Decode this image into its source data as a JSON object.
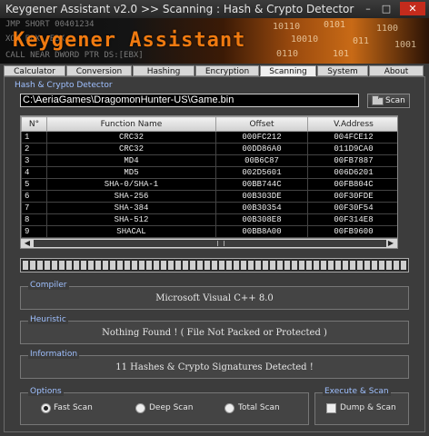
{
  "window": {
    "title": "Keygener Assistant v2.0  >>  Scanning : Hash & Crypto Detector",
    "minimize": "–",
    "maximize": "□",
    "close": "✕"
  },
  "banner": {
    "logo_text": "Keygener Assistant",
    "asm_lines": [
      "JMP      SHORT 00401234",
      "XOR EBX, EBX",
      "CALL      NEAR DWORD PTR DS:[EBX]"
    ],
    "bits": [
      "10110",
      "0101",
      "1100",
      "10010",
      "011",
      "1001",
      "0110",
      "101"
    ]
  },
  "tabs": [
    "Calculator",
    "Conversion",
    "Hashing",
    "Encryption",
    "Scanning",
    "System",
    "About"
  ],
  "active_tab": "Scanning",
  "detector": {
    "section_title": "Hash & Crypto Detector",
    "path": "C:\\AeriaGames\\DragomonHunter-US\\Game.bin",
    "scan_button": "Scan"
  },
  "results": {
    "columns": [
      "N°",
      "Function Name",
      "Offset",
      "V.Address"
    ],
    "rows": [
      [
        "1",
        "CRC32",
        "000FC212",
        "004FCE12"
      ],
      [
        "2",
        "CRC32",
        "00DD86A0",
        "011D9CA0"
      ],
      [
        "3",
        "MD4",
        "00B6C87",
        "00FB7887"
      ],
      [
        "4",
        "MD5",
        "002D5601",
        "006D6201"
      ],
      [
        "5",
        "SHA-0/SHA-1",
        "00BB744C",
        "00FB804C"
      ],
      [
        "6",
        "SHA-256",
        "00B303DE",
        "00F30FDE"
      ],
      [
        "7",
        "SHA-384",
        "00B30354",
        "00F30F54"
      ],
      [
        "8",
        "SHA-512",
        "00B308E8",
        "00F314E8"
      ],
      [
        "9",
        "SHACAL",
        "00BB8A00",
        "00FB9600"
      ]
    ]
  },
  "progress": {
    "fraction": 1.0
  },
  "compiler": {
    "label": "Compiler",
    "value": "Microsoft Visual C++ 8.0"
  },
  "heuristic": {
    "label": "Heuristic",
    "value": "Nothing Found ! ( File Not Packed or Protected )"
  },
  "information": {
    "label": "Information",
    "value": "11 Hashes & Crypto Signatures Detected !"
  },
  "options": {
    "label": "Options",
    "choices": [
      "Fast Scan",
      "Deep Scan",
      "Total Scan"
    ],
    "selected": "Fast Scan"
  },
  "execute": {
    "label": "Execute & Scan",
    "checkbox_label": "Dump & Scan",
    "checked": false
  },
  "colors": {
    "logo": "#f07a10",
    "section_title": "#9fc0ff",
    "grid_background": "#000000"
  }
}
